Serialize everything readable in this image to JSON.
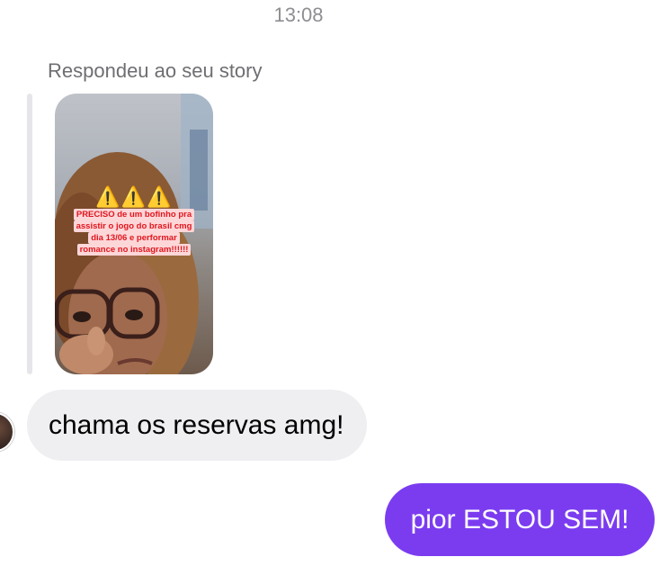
{
  "thread": {
    "timestamp": "13:08",
    "reply_context": "Respondeu ao seu story",
    "story": {
      "warning_icons": "⚠️⚠️⚠️",
      "caption_lines": [
        "PRECISO de um bofinho pra",
        "assistir o jogo do brasil cmg",
        "dia 13/06 e performar",
        "romance no instagram!!!!!!"
      ]
    },
    "messages": [
      {
        "sender": "them",
        "text": "chama os reservas amg!"
      },
      {
        "sender": "me",
        "text": "pior ESTOU SEM!"
      }
    ]
  },
  "colors": {
    "outgoing_bubble": "#7b3cf0",
    "incoming_bubble": "#efeff2",
    "story_caption_text": "#e0161e",
    "story_caption_bg": "#fdd6d8"
  }
}
